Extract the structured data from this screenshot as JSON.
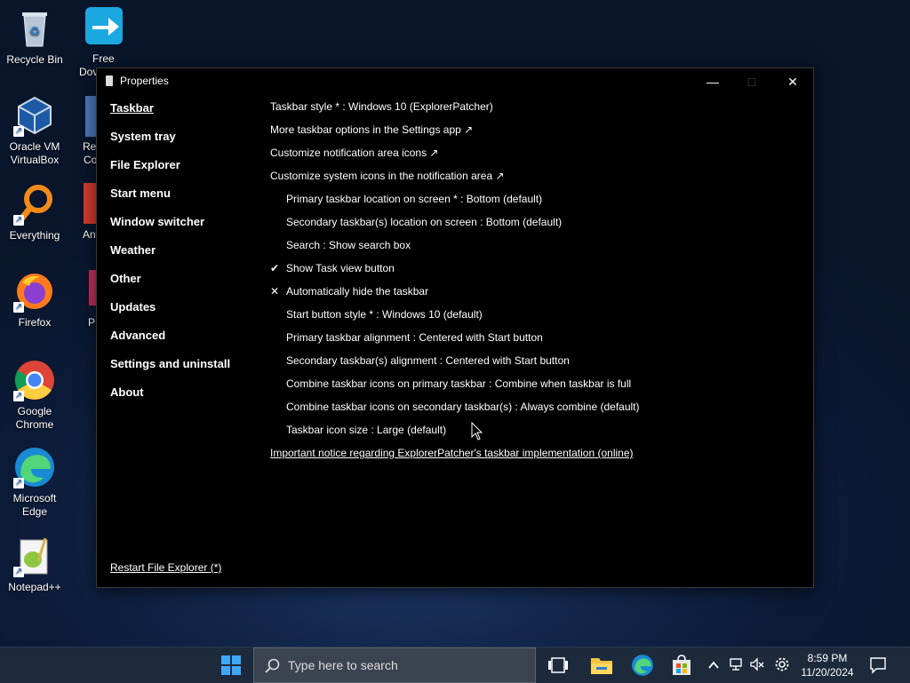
{
  "desktop": {
    "icons": [
      {
        "label": "Recycle Bin"
      },
      {
        "label": "Oracle VM VirtualBox"
      },
      {
        "label": "Everything"
      },
      {
        "label": "Firefox"
      },
      {
        "label": "Google Chrome"
      },
      {
        "label": "Microsoft Edge"
      },
      {
        "label": "Notepad++"
      }
    ],
    "partial_icons": [
      {
        "label": "Free"
      },
      {
        "label": "Dov"
      },
      {
        "label": "Re"
      },
      {
        "label": "Co"
      },
      {
        "label": "An"
      },
      {
        "label": "P"
      }
    ]
  },
  "window": {
    "title": "Properties",
    "controls": {
      "minimize": "—",
      "maximize": "□",
      "close": "✕"
    },
    "nav": [
      {
        "label": "Taskbar"
      },
      {
        "label": "System tray"
      },
      {
        "label": "File Explorer"
      },
      {
        "label": "Start menu"
      },
      {
        "label": "Window switcher"
      },
      {
        "label": "Weather"
      },
      {
        "label": "Other"
      },
      {
        "label": "Updates"
      },
      {
        "label": "Advanced"
      },
      {
        "label": "Settings and uninstall"
      },
      {
        "label": "About"
      }
    ],
    "restart_link": "Restart File Explorer (*)",
    "settings": [
      {
        "text": "Taskbar style * : Windows 10 (ExplorerPatcher)"
      },
      {
        "text": "More taskbar options in the Settings app ↗"
      },
      {
        "text": "Customize notification area icons ↗"
      },
      {
        "text": "Customize system icons in the notification area ↗"
      },
      {
        "text": "Primary taskbar location on screen * : Bottom (default)"
      },
      {
        "text": "Secondary taskbar(s) location on screen : Bottom (default)"
      },
      {
        "text": "Search : Show search box"
      },
      {
        "text": "Show Task view button",
        "mark": "✔"
      },
      {
        "text": "Automatically hide the taskbar",
        "mark": "✕"
      },
      {
        "text": "Start button style * : Windows 10 (default)"
      },
      {
        "text": "Primary taskbar alignment : Centered with Start button"
      },
      {
        "text": "Secondary taskbar(s) alignment : Centered with Start button"
      },
      {
        "text": "Combine taskbar icons on primary taskbar : Combine when taskbar is full"
      },
      {
        "text": "Combine taskbar icons on secondary taskbar(s) : Always combine (default)"
      },
      {
        "text": "Taskbar icon size : Large (default)"
      },
      {
        "text": "Important notice regarding ExplorerPatcher's taskbar implementation (online)"
      }
    ]
  },
  "taskbar": {
    "search_placeholder": "Type here to search",
    "time": "8:59 PM",
    "date": "11/20/2024"
  },
  "colors": {
    "taskbar_bg": "#1c2a3c",
    "window_bg": "#000000",
    "search_bg": "#3b4350"
  }
}
